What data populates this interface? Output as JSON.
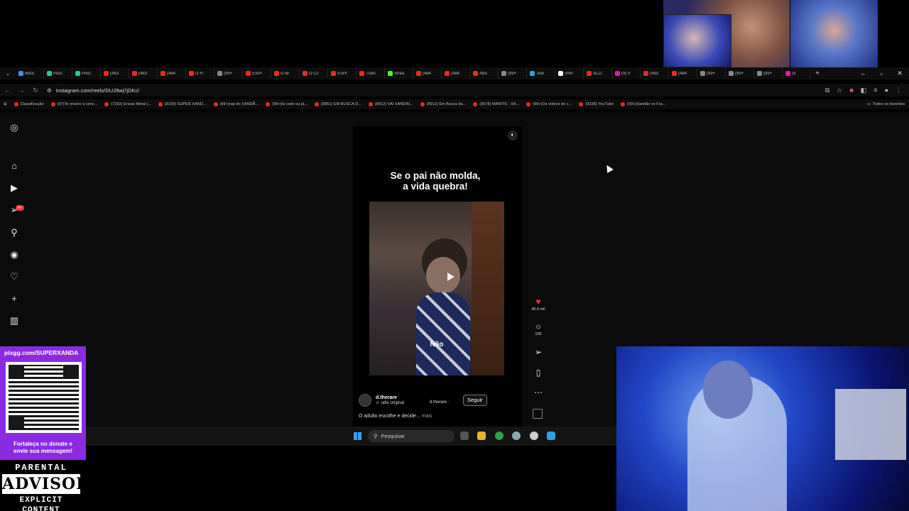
{
  "browser": {
    "tabs": [
      {
        "label": "Bitco",
        "color": "#4a8cff"
      },
      {
        "label": "PixG",
        "color": "#32c88c"
      },
      {
        "label": "PixG",
        "color": "#32c88c"
      },
      {
        "label": "(483",
        "color": "#e52d27"
      },
      {
        "label": "(483",
        "color": "#e52d27"
      },
      {
        "label": "(484",
        "color": "#e52d27"
      },
      {
        "label": "O Fi",
        "color": "#e52d27"
      },
      {
        "label": "(99+",
        "color": "#888888"
      },
      {
        "label": "ESPI",
        "color": "#e52d27"
      },
      {
        "label": "O Br",
        "color": "#e52d27"
      },
      {
        "label": "O Cc",
        "color": "#e52d27"
      },
      {
        "label": "ESPI",
        "color": "#e52d27"
      },
      {
        "label": "Tram",
        "color": "#e52d27"
      },
      {
        "label": "Strea",
        "color": "#53fc18"
      },
      {
        "label": "(484",
        "color": "#e52d27"
      },
      {
        "label": "(484",
        "color": "#e52d27"
      },
      {
        "label": "Abo",
        "color": "#e52d27"
      },
      {
        "label": "(99+",
        "color": "#888888"
      },
      {
        "label": "Tele",
        "color": "#2aa3e0"
      },
      {
        "label": "VIRI",
        "color": "#ffffff"
      },
      {
        "label": "ALLI",
        "color": "#e52d27"
      },
      {
        "label": "(9) Ir",
        "color": "#d6249f"
      },
      {
        "label": "(483",
        "color": "#e52d27"
      },
      {
        "label": "(484",
        "color": "#e52d27"
      },
      {
        "label": "(99+",
        "color": "#888888"
      },
      {
        "label": "(99+",
        "color": "#888888"
      },
      {
        "label": "(99+",
        "color": "#888888"
      },
      {
        "label": "(9",
        "color": "#d6249f"
      }
    ],
    "new_tab": "+",
    "url": "instagram.com/reels/DUJ9wj7jDKc/"
  },
  "bookmarks": {
    "items": [
      "Classificação",
      "(97)Te ensino a venc...",
      "(7292) Eneas Metal |...",
      "(8159) SUPER XAND...",
      "(99+)rap do XANDÃ...",
      "(99+)tá cedo ou já...",
      "(8851) EM BUSCA D...",
      "(8912) VAI XANDIN...",
      "(8912) Em Busca da...",
      "(9078) MANTIS - XA...",
      "(99+)Os vídeos de c...",
      "(9338) YouTube",
      "(99+)Xandão vs Fra..."
    ],
    "all": "Todos os favoritos"
  },
  "sidebar": {
    "badge": "9+"
  },
  "reel": {
    "caption_top_1": "Se o pai não molda,",
    "caption_top_2": "a vida quebra!",
    "subtitle": "Não",
    "author": "d.therare",
    "audio": "♬ udio original",
    "audio2": "d.therare ·",
    "follow": "Seguir",
    "description": "O adulto escolhe e decide... ",
    "more": "mais",
    "likes": "45,4 mil",
    "comments": "155"
  },
  "taskbar": {
    "search": "Pesquisar"
  },
  "overlay": {
    "qr_url": "pixgg.com/SUPERXANDA",
    "qr_cta_1": "Fortaleça no donate e",
    "qr_cta_2": "envie sua mensagem!",
    "advisory_top": "PARENTAL",
    "advisory_mid": "ADVISORY",
    "advisory_bot": "EXPLICIT CONTENT"
  },
  "colors": {
    "accent_like": "#ff3040",
    "instagram_badge": "#ff3040",
    "qr_panel": "#8a2be2"
  }
}
